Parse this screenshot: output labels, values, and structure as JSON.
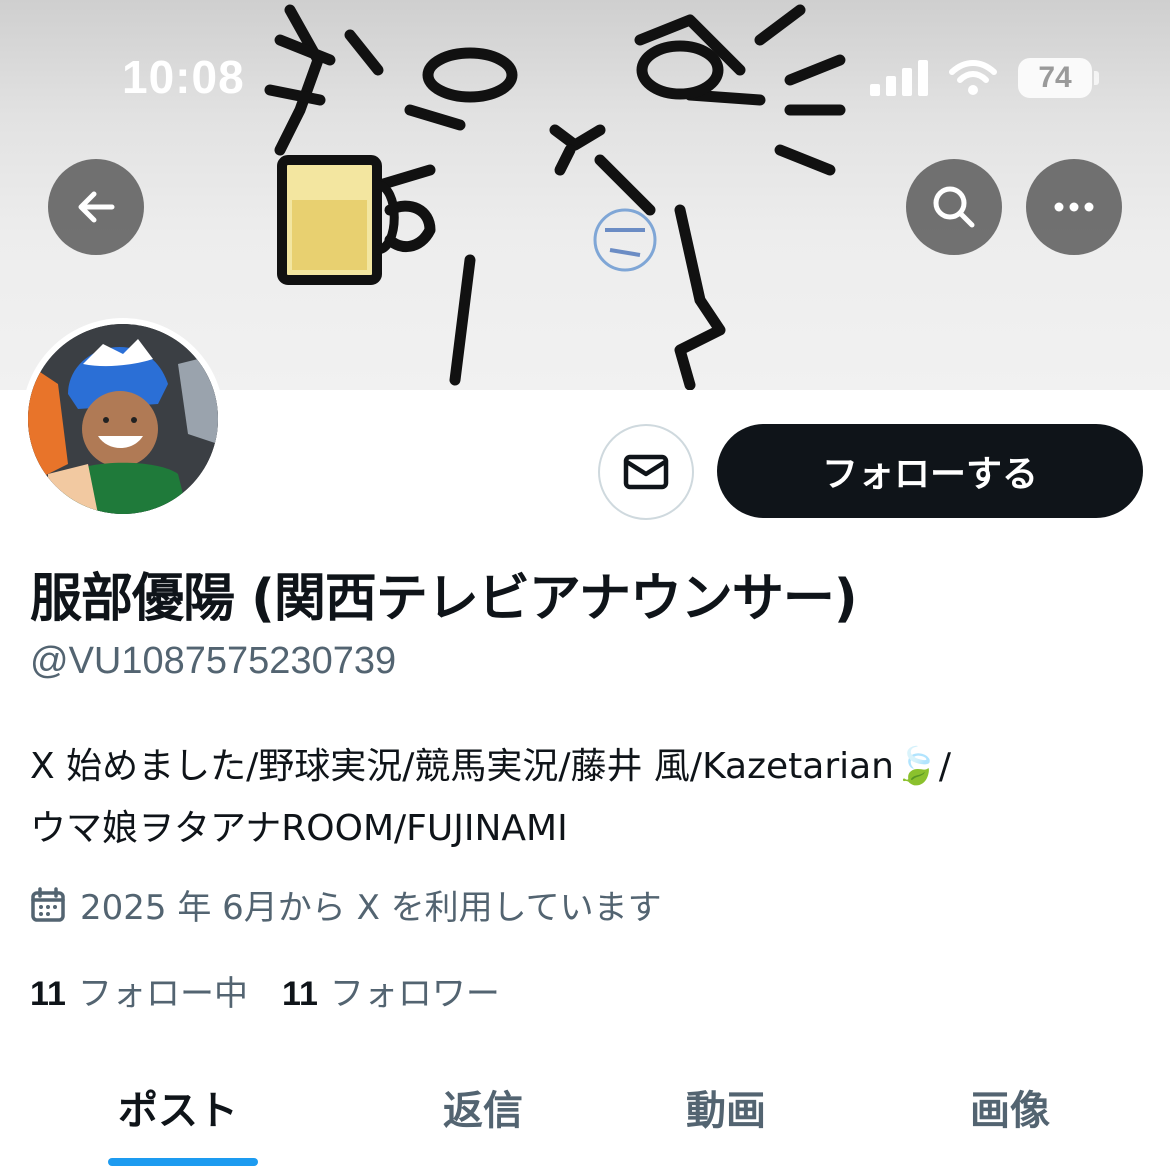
{
  "status_bar": {
    "time": "10:08",
    "battery": "74",
    "icons": [
      "signal-icon",
      "wifi-icon",
      "battery-icon"
    ]
  },
  "header": {
    "back_icon": "arrow-left-icon",
    "search_icon": "search-icon",
    "more_icon": "more-horizontal-icon"
  },
  "profile": {
    "display_name": "服部優陽 (関西テレビアナウンサー)",
    "handle": "@VU1087575230739",
    "bio_line1_text": "X 始めました/野球実況/競馬実況/藤井 風/Kazetarian",
    "bio_line1_emoji": "🍃",
    "bio_line1_end": "/",
    "bio_line2": "ウマ娘ヲタアナROOM/FUJINAMI",
    "joined": "2025 年 6月から X を利用しています",
    "following_count": "11",
    "following_label": "フォロー中",
    "followers_count": "11",
    "followers_label": "フォロワー"
  },
  "actions": {
    "message_icon": "envelope-icon",
    "follow_label": "フォローする"
  },
  "tabs": [
    {
      "label": "ポスト",
      "active": true
    },
    {
      "label": "返信",
      "active": false
    },
    {
      "label": "動画",
      "active": false
    },
    {
      "label": "画像",
      "active": false
    }
  ],
  "colors": {
    "accent": "#1d9bf0",
    "primary_text": "#0f1419",
    "secondary_text": "#536471",
    "follow_button_bg": "#0f1419"
  }
}
